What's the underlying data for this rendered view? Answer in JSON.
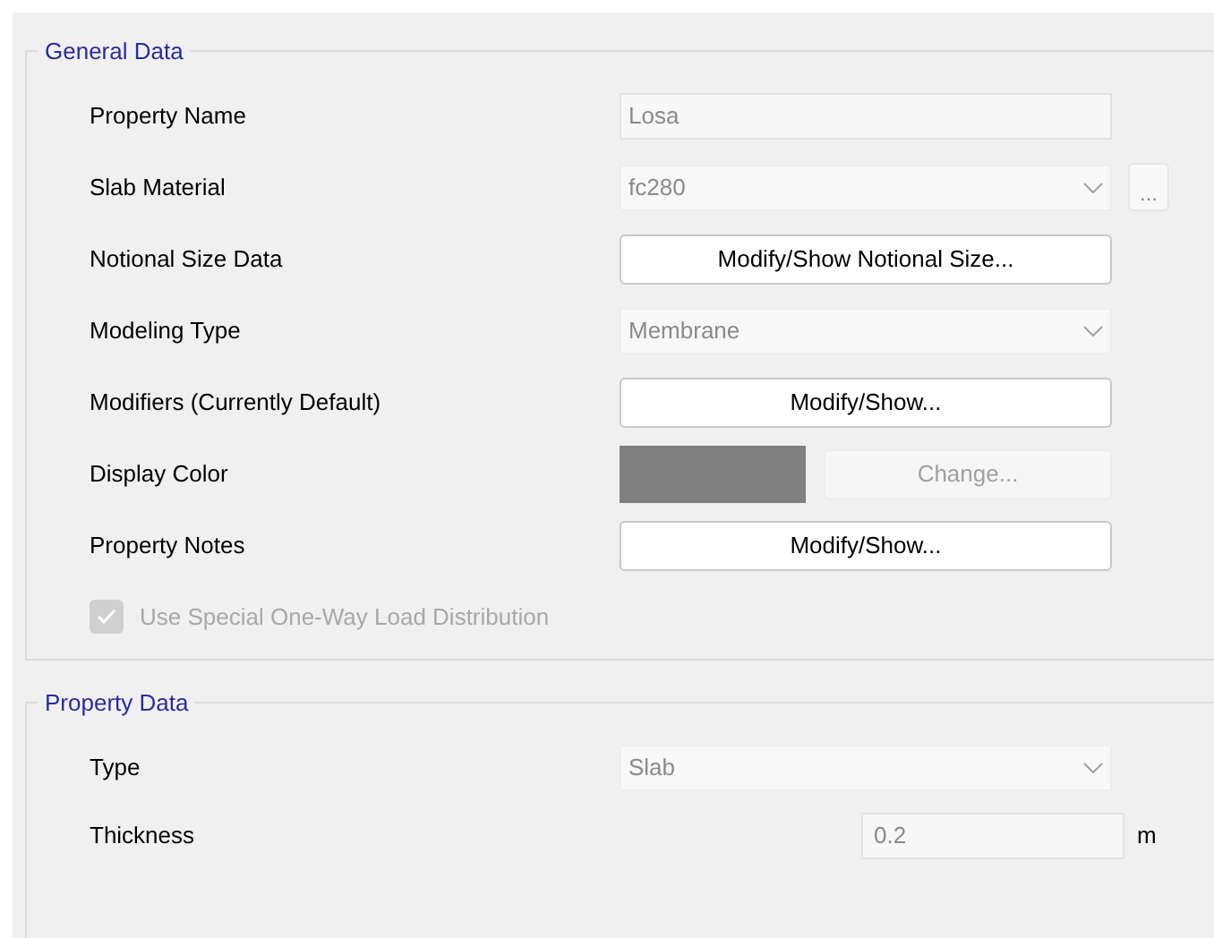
{
  "general_data": {
    "title": "General Data",
    "rows": [
      {
        "kind": "text",
        "label": "Property Name",
        "value": "Losa",
        "disabled": true
      },
      {
        "kind": "combo",
        "label": "Slab Material",
        "value": "fc280",
        "disabled": true,
        "extra_button": "..."
      },
      {
        "kind": "button",
        "label": "Notional Size Data",
        "button": "Modify/Show Notional Size..."
      },
      {
        "kind": "combo",
        "label": "Modeling Type",
        "value": "Membrane",
        "disabled": true
      },
      {
        "kind": "button",
        "label": "Modifiers (Currently Default)",
        "button": "Modify/Show..."
      },
      {
        "kind": "color",
        "label": "Display Color",
        "color": "#808080",
        "button": "Change...",
        "disabled": true
      },
      {
        "kind": "button",
        "label": "Property Notes",
        "button": "Modify/Show..."
      }
    ],
    "checkbox": {
      "label": "Use Special One-Way Load Distribution",
      "checked": true,
      "disabled": true
    }
  },
  "property_data": {
    "title": "Property Data",
    "rows": [
      {
        "kind": "combo",
        "label": "Type",
        "value": "Slab",
        "disabled": true
      },
      {
        "kind": "number",
        "label": "Thickness",
        "value": "0.2",
        "unit": "m",
        "disabled": true
      }
    ]
  }
}
